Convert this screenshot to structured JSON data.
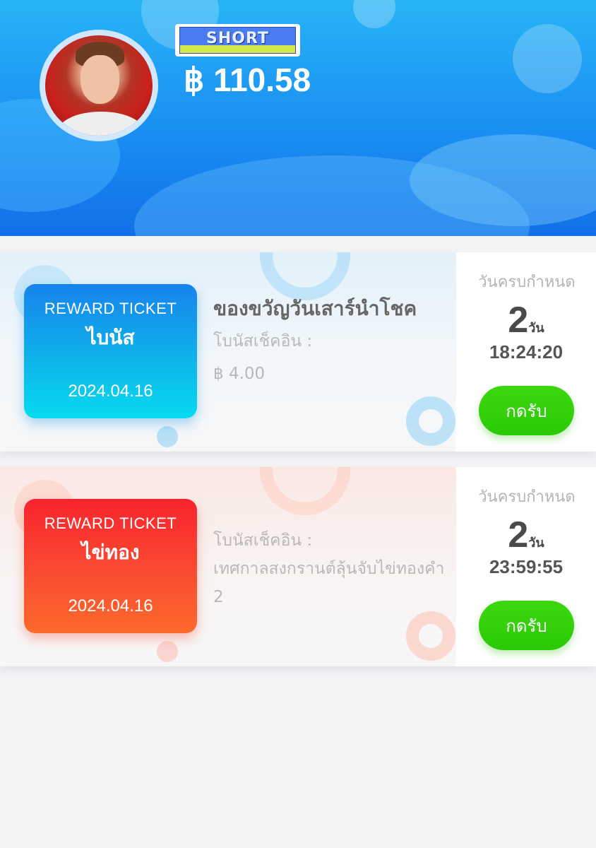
{
  "header": {
    "badge_text": "SHORT",
    "balance": "฿ 110.58"
  },
  "tickets": [
    {
      "label": "REWARD TICKET",
      "type": "ไบนัส",
      "date": "2024.04.16",
      "title": "ของขวัญวันเสาร์นำโชค",
      "line1": "โบนัสเช็คอิน :",
      "line2": "฿ 4.00",
      "due_label": "วันครบกำหนด",
      "days_num": "2",
      "days_unit": "วัน",
      "countdown": "18:24:20",
      "claim_label": "กดรับ",
      "theme_color": "#1783ec"
    },
    {
      "label": "REWARD TICKET",
      "type": "ไข่ทอง",
      "date": "2024.04.16",
      "line1": "โบนัสเช็คอิน :",
      "line2": "เทศกาลสงกรานต์ลุ้นจับไข่ทองคำ 2",
      "due_label": "วันครบกำหนด",
      "days_num": "2",
      "days_unit": "วัน",
      "countdown": "23:59:55",
      "claim_label": "กดรับ",
      "theme_color": "#f8242e"
    }
  ],
  "colors": {
    "header_blue": "#1a8ff2",
    "claim_green": "#2cc907",
    "page_bg": "#f3f3f6"
  }
}
